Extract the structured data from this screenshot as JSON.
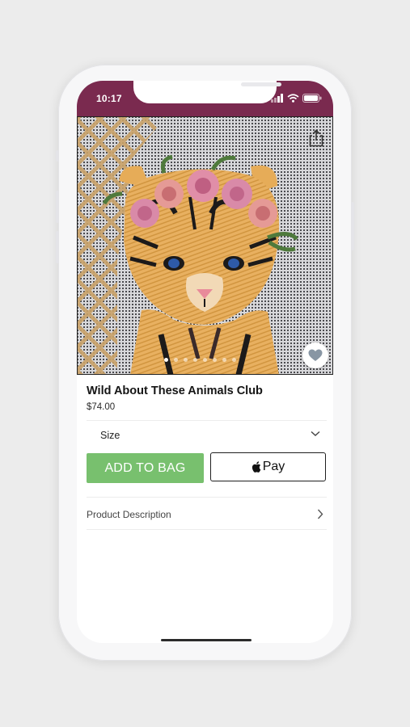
{
  "status_bar": {
    "time": "10:17",
    "color": "#7a2a4f"
  },
  "product": {
    "title": "Wild About These Animals Club",
    "price": "$74.00",
    "image_count": 8,
    "active_image": 1
  },
  "options": {
    "size_label": "Size"
  },
  "buttons": {
    "add_to_bag": "ADD TO BAG",
    "apple_pay": "Pay",
    "add_color": "#78c06e"
  },
  "sections": {
    "description_label": "Product Description"
  }
}
